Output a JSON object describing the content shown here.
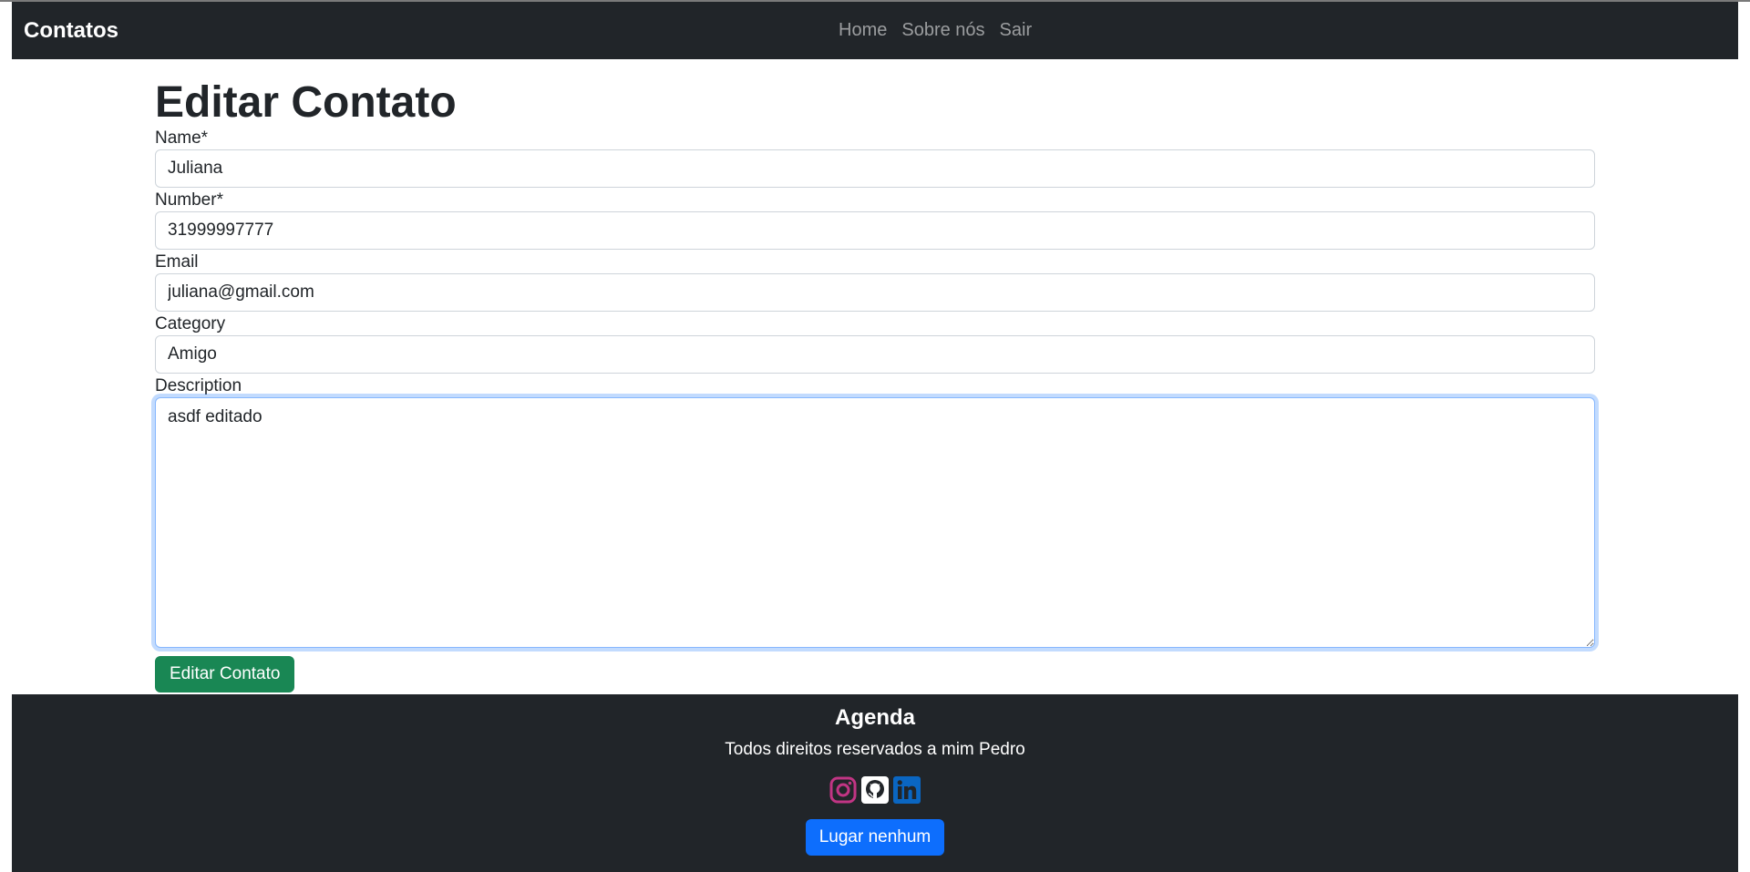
{
  "navbar": {
    "brand": "Contatos",
    "links": [
      "Home",
      "Sobre nós",
      "Sair"
    ]
  },
  "page": {
    "title": "Editar Contato"
  },
  "form": {
    "name_label": "Name*",
    "name_value": "Juliana",
    "number_label": "Number*",
    "number_value": "31999997777",
    "email_label": "Email",
    "email_value": "juliana@gmail.com",
    "category_label": "Category",
    "category_value": "Amigo",
    "description_label": "Description",
    "description_value": "asdf editado",
    "submit_label": "Editar Contato"
  },
  "footer": {
    "title": "Agenda",
    "text": "Todos direitos reservados a mim Pedro",
    "social": [
      "instagram-icon",
      "github-icon",
      "linkedin-icon"
    ],
    "button_label": "Lugar nenhum"
  },
  "colors": {
    "navbar_bg": "#212529",
    "success": "#198754",
    "primary": "#0d6efd",
    "instagram": "#c13584",
    "linkedin": "#0a66c2"
  }
}
